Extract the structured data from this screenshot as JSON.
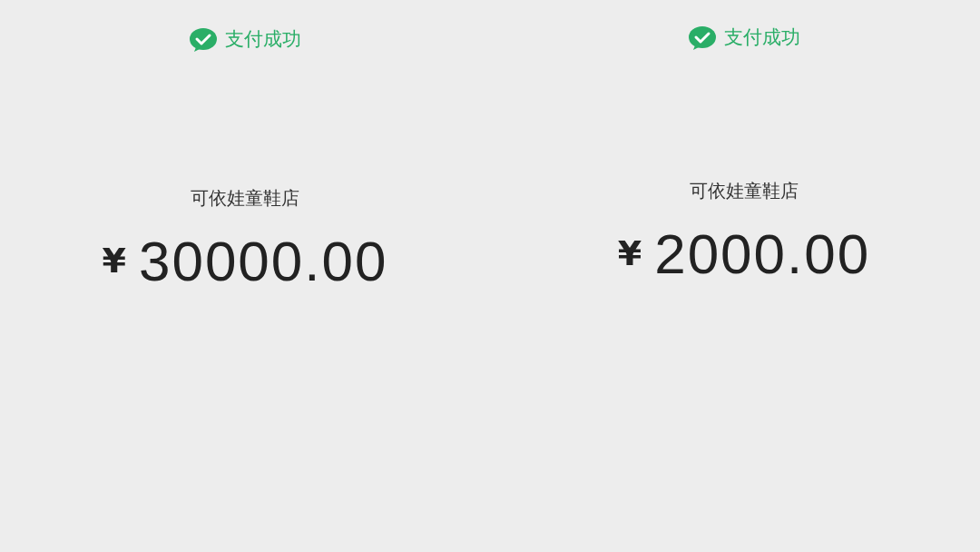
{
  "panels": [
    {
      "status": "支付成功",
      "merchant": "可依娃童鞋店",
      "currency": "¥",
      "amount": "30000.00"
    },
    {
      "status": "支付成功",
      "merchant": "可依娃童鞋店",
      "currency": "¥",
      "amount": "2000.00"
    }
  ]
}
